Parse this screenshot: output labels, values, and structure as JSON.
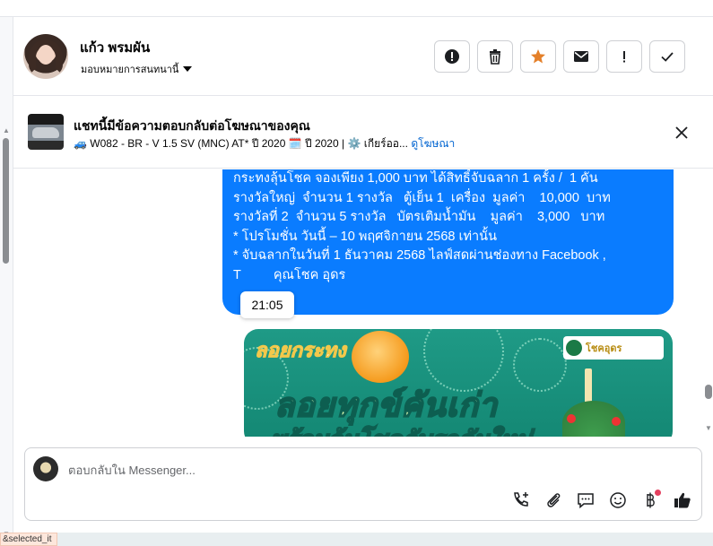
{
  "header": {
    "name": "แก้ว พรมผัน",
    "assign_label": "มอบหมายการสนทนานี้"
  },
  "ad": {
    "title": "แชทนี้มีข้อความตอบกลับต่อโฆษณาของคุณ",
    "subtitle_prefix": "🚙 W082 - BR - V 1.5 SV (MNC) AT* ปี 2020 🗓️ ปี 2020 | ⚙️ เกียร์ออ...",
    "link": "ดูโฆษณา"
  },
  "message": {
    "lines": [
      "กระทงลุ้นโชค จองเพียง 1,000 บาท ได้สิทธิ์จับฉลาก 1 ครั้ง /  1 คัน",
      "รางวัลใหญ่  จำนวน 1 รางวัล   ตู้เย็น 1  เครื่อง  มูลค่า    10,000  บาท",
      "รางวัลที่ 2  จำนวน 5 รางวัล   บัตรเติมน้ำมัน    มูลค่า    3,000   บาท",
      "",
      "* โปรโมชั่น วันนี้ – 10 พฤศจิกายน 2568 เท่านั้น",
      "* จับฉลากในวันที่ 1 ธันวาคม 2568 ไลฟ์สดผ่านช่องทาง Facebook ,",
      "T         คุณโชค อุดร"
    ],
    "timestamp": "21:05"
  },
  "promo": {
    "logo_text": "ลอยกระทง",
    "headline": "ลอยทุกข์คันเก่า",
    "headline2": "พร้อมลุ้นโชคกับรถคันใหม่",
    "brand": "โชคอุดร"
  },
  "composer": {
    "placeholder": "ตอบกลับใน Messenger..."
  },
  "bottom": {
    "tab_text": "&selected_it"
  },
  "icons": {
    "actions": [
      "alert-circle-icon",
      "trash-icon",
      "star-icon",
      "mail-icon",
      "exclamation-icon",
      "check-icon"
    ],
    "tools": [
      "phone-add-icon",
      "paperclip-icon",
      "chat-bubble-icon",
      "smiley-icon",
      "baht-icon",
      "thumbs-up-icon"
    ]
  },
  "colors": {
    "bubble": "#0a7cff",
    "link": "#0064d1",
    "star": "#e4802a"
  }
}
